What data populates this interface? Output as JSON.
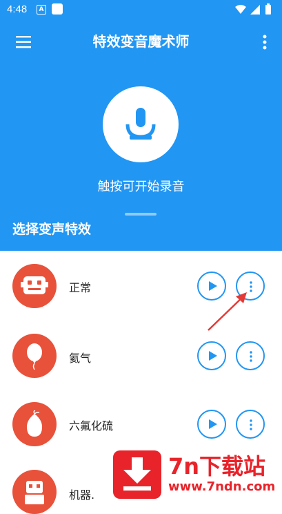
{
  "status_bar": {
    "time": "4:48",
    "notif_icon": "A"
  },
  "toolbar": {
    "title": "特效变音魔术师"
  },
  "recorder": {
    "hint": "触按可开始录音"
  },
  "section": {
    "title": "选择变声特效"
  },
  "effects": [
    {
      "name": "正常",
      "icon": "robot-face-icon"
    },
    {
      "name": "氦气",
      "icon": "balloon-icon"
    },
    {
      "name": "六氟化硫",
      "icon": "heavy-balloon-icon"
    },
    {
      "name": "机器.",
      "icon": "robot-icon"
    }
  ],
  "watermark": {
    "title": "7n下载站",
    "url": "www.7ndn.com"
  },
  "colors": {
    "primary": "#2196F3",
    "avatar": "#E8513A",
    "watermark": "#E8232A"
  }
}
